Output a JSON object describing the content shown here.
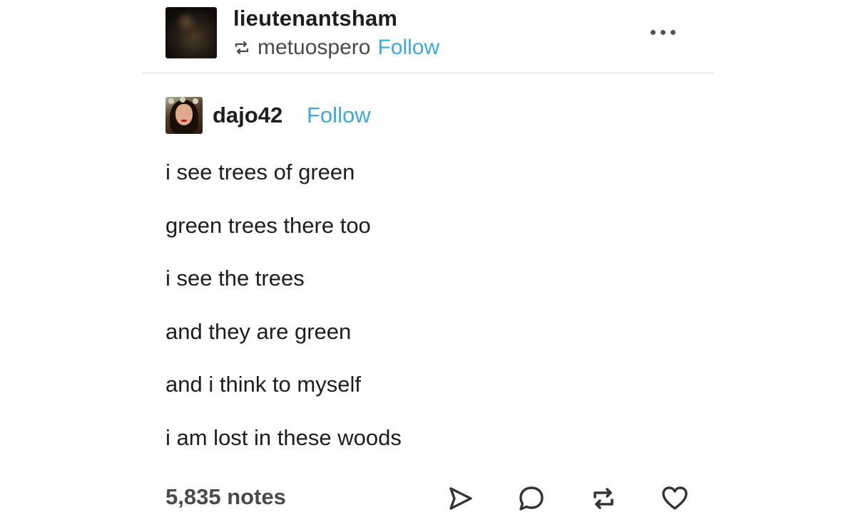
{
  "post": {
    "blog_name": "lieutenantsham",
    "reblogged_from": "metuospero",
    "follow_label": "Follow",
    "more_menu_icon": "more-dots-icon",
    "trail": {
      "username": "dajo42",
      "follow_label": "Follow",
      "lines": [
        "i see trees of green",
        "green trees there too",
        "i see the trees",
        "and they are green",
        "and i think to myself",
        "i am lost in these woods"
      ]
    },
    "footer": {
      "notes": "5,835 notes",
      "actions": [
        "share-icon",
        "reply-icon",
        "reblog-icon",
        "like-icon"
      ]
    }
  },
  "colors": {
    "accent_link": "#3da9d8",
    "text_primary": "#1d1d1d",
    "text_secondary": "#4a4a4a",
    "divider": "#d9d9d9"
  }
}
